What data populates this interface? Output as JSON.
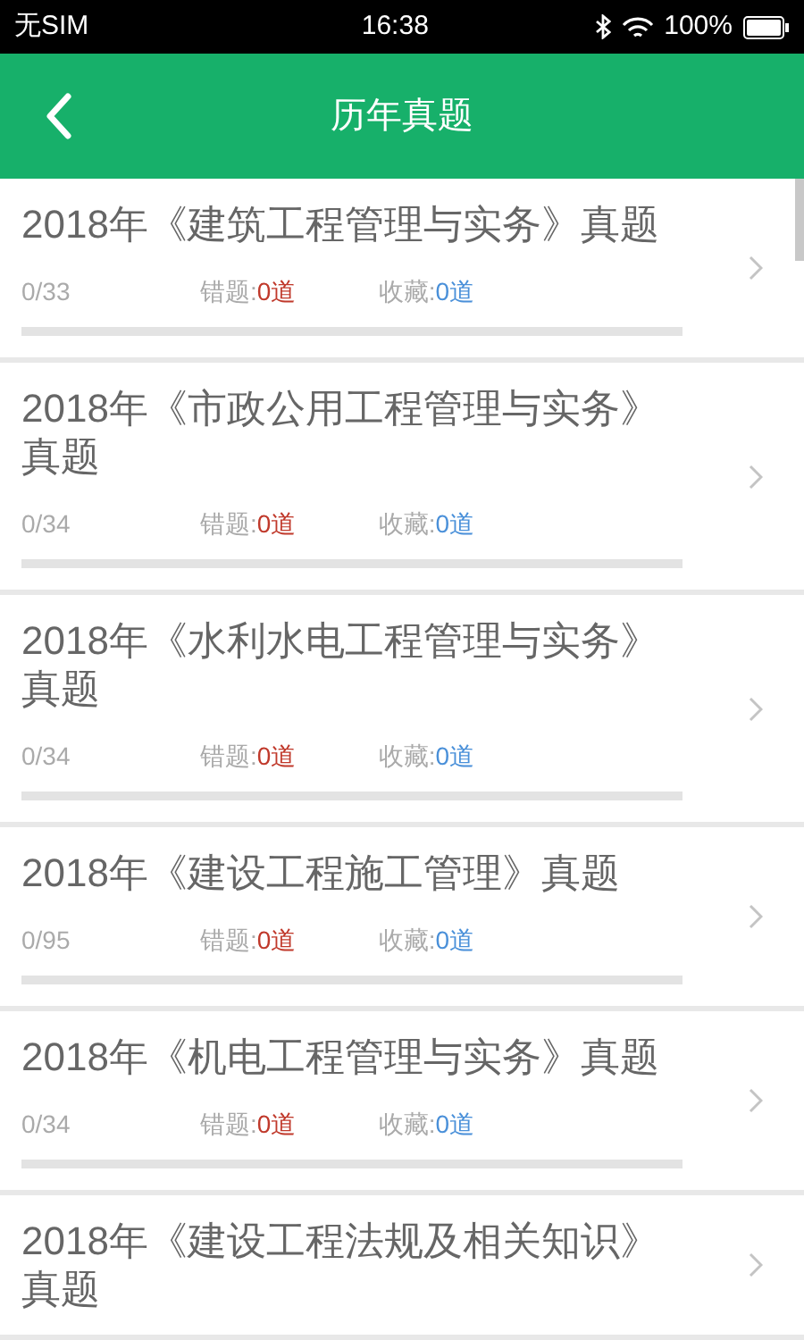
{
  "status_bar": {
    "carrier": "无SIM",
    "time": "16:38",
    "battery": "100%"
  },
  "header": {
    "title": "历年真题"
  },
  "items": [
    {
      "title": "2018年《建筑工程管理与实务》真题",
      "progress": "0/33",
      "wrong_label": "错题:",
      "wrong_count": "0道",
      "fav_label": "收藏:",
      "fav_count": "0道",
      "level": 0
    },
    {
      "title": "2018年《市政公用工程管理与实务》真题",
      "progress": "0/34",
      "wrong_label": "错题:",
      "wrong_count": "0道",
      "fav_label": "收藏:",
      "fav_count": "0道",
      "level": 0
    },
    {
      "title": "2018年《水利水电工程管理与实务》真题",
      "progress": "0/34",
      "wrong_label": "错题:",
      "wrong_count": "0道",
      "fav_label": "收藏:",
      "fav_count": "0道",
      "level": 0
    },
    {
      "title": "2018年《建设工程施工管理》真题",
      "progress": "0/95",
      "wrong_label": "错题:",
      "wrong_count": "0道",
      "fav_label": "收藏:",
      "fav_count": "0道",
      "level": 0
    },
    {
      "title": "2018年《机电工程管理与实务》真题",
      "progress": "0/34",
      "wrong_label": "错题:",
      "wrong_count": "0道",
      "fav_label": "收藏:",
      "fav_count": "0道",
      "level": 0
    },
    {
      "title": "2018年《建设工程法规及相关知识》真题"
    }
  ]
}
